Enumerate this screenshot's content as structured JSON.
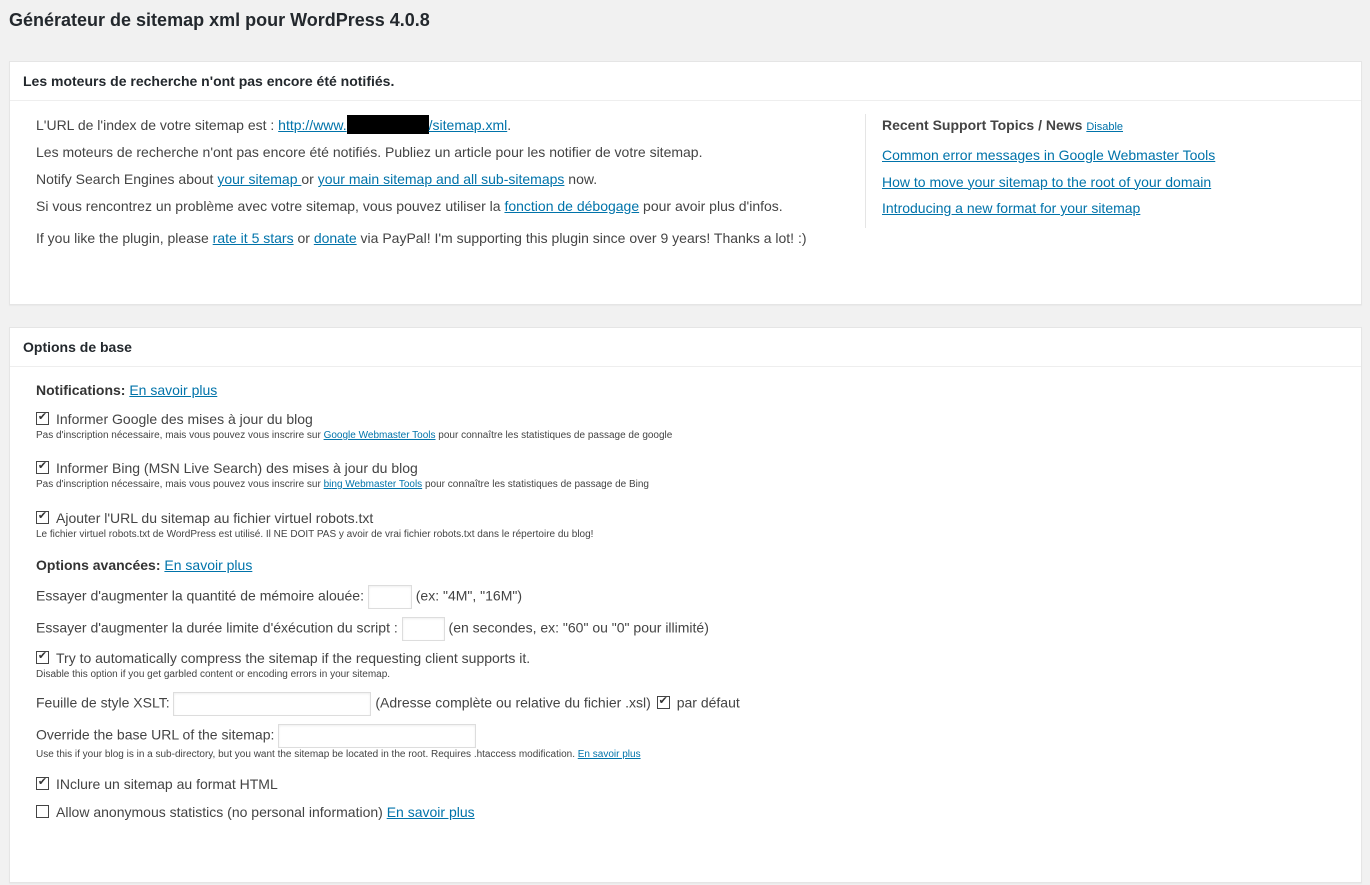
{
  "page": {
    "title": "Générateur de sitemap xml pour WordPress 4.0.8"
  },
  "status_box": {
    "heading": "Les moteurs de recherche n'ont pas encore été notifiés.",
    "line1_prefix": "L'URL de l'index de votre sitemap est : ",
    "line1_link_start": "http://www.",
    "line1_link_end": "/sitemap.xml",
    "line1_suffix": ".",
    "line2": "Les moteurs de recherche n'ont pas encore été notifiés. Publiez un article pour les notifier de votre sitemap.",
    "line3_prefix": "Notify Search Engines about ",
    "line3_link1": "your sitemap ",
    "line3_mid": "or ",
    "line3_link2": "your main sitemap and all sub-sitemaps",
    "line3_suffix": " now.",
    "line4_prefix": "Si vous rencontrez un problème avec votre sitemap, vous pouvez utiliser la ",
    "line4_link": "fonction de débogage",
    "line4_suffix": " pour avoir plus d'infos.",
    "like_prefix": "If you like the plugin, please ",
    "like_link1": "rate it 5 stars",
    "like_mid": " or ",
    "like_link2": "donate",
    "like_suffix": " via PayPal! I'm supporting this plugin since over 9 years! Thanks a lot! :)",
    "support": {
      "heading": "Recent Support Topics / News",
      "disable_label": "Disable",
      "topics": [
        "Common error messages in Google Webmaster Tools",
        "How to move your sitemap to the root of your domain",
        "Introducing a new format for your sitemap"
      ]
    }
  },
  "options_box": {
    "heading": "Options de base",
    "notifications": {
      "label": "Notifications:",
      "link": "En savoir plus"
    },
    "google": {
      "label": "Informer Google des mises à jour du blog",
      "checked": true,
      "help_prefix": "Pas d'inscription nécessaire, mais vous pouvez vous inscrire sur ",
      "help_link": "Google Webmaster Tools",
      "help_suffix": " pour connaître les statistiques de passage de google"
    },
    "bing": {
      "label": "Informer Bing (MSN Live Search) des mises à jour du blog",
      "checked": true,
      "help_prefix": "Pas d'inscription nécessaire, mais vous pouvez vous inscrire sur ",
      "help_link": "bing Webmaster Tools",
      "help_suffix": " pour connaître les statistiques de passage de Bing"
    },
    "robots": {
      "label": "Ajouter l'URL du sitemap au fichier virtuel robots.txt",
      "checked": true,
      "help": "Le fichier virtuel robots.txt de WordPress est utilisé. Il NE DOIT PAS y avoir de vrai fichier robots.txt dans le répertoire du blog!"
    },
    "advanced": {
      "label": "Options avancées:",
      "link": "En savoir plus"
    },
    "memory": {
      "label": "Essayer d'augmenter la quantité de mémoire alouée: ",
      "value": "",
      "hint": "(ex: \"4M\", \"16M\")"
    },
    "time": {
      "label": "Essayer d'augmenter la durée limite d'éxécution du script : ",
      "value": "",
      "hint": "(en secondes, ex: \"60\" ou \"0\" pour illimité)"
    },
    "compress": {
      "label": "Try to automatically compress the sitemap if the requesting client supports it.",
      "checked": true,
      "help": "Disable this option if you get garbled content or encoding errors in your sitemap."
    },
    "xslt": {
      "label": "Feuille de style XSLT: ",
      "value": "",
      "hint": "(Adresse complète ou relative du fichier .xsl)",
      "default_label": "par défaut",
      "default_checked": true
    },
    "baseurl": {
      "label": "Override the base URL of the sitemap: ",
      "value": "",
      "help_prefix": "Use this if your blog is in a sub-directory, but you want the sitemap be located in the root. Requires .htaccess modification. ",
      "help_link": "En savoir plus"
    },
    "html_sitemap": {
      "label": "INclure un sitemap au format HTML",
      "checked": true
    },
    "anon_stats": {
      "label": "Allow anonymous statistics (no personal information) ",
      "link": "En savoir plus",
      "checked": false
    }
  },
  "colors": {
    "link": "#0073aa",
    "background": "#f1f1f1",
    "panel": "#ffffff",
    "text": "#444444"
  }
}
